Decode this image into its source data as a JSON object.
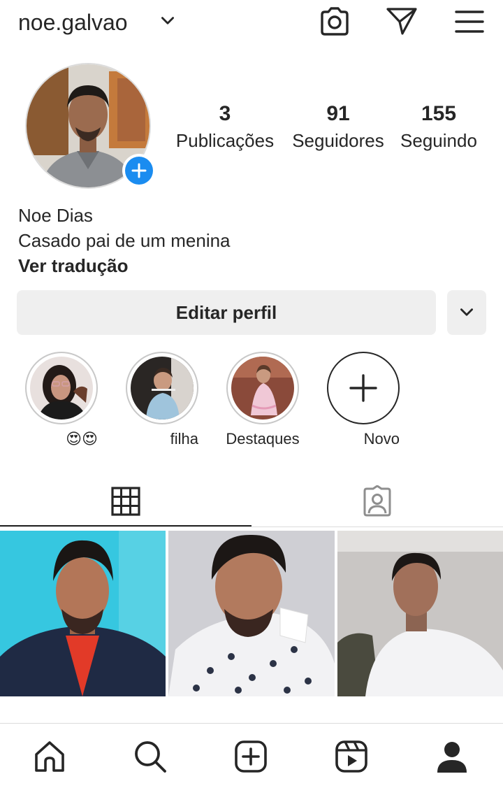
{
  "header": {
    "username": "noe.galvao",
    "icons": [
      "chevron-down-icon",
      "camera-icon",
      "direct-message-icon",
      "menu-icon"
    ]
  },
  "profile": {
    "avatar_icon": "profile-photo",
    "add_story_icon": "plus-icon",
    "accent_color": "#1a8cf0"
  },
  "stats": [
    {
      "value": "3",
      "label": "Publicações"
    },
    {
      "value": "91",
      "label": "Seguidores"
    },
    {
      "value": "155",
      "label": "Seguindo"
    }
  ],
  "bio": {
    "name": "Noe Dias",
    "text": "Casado pai de um menina",
    "translate": "Ver tradução"
  },
  "actions": {
    "edit_profile": "Editar perfil",
    "more_icon": "chevron-down-icon"
  },
  "highlights": [
    {
      "label": "😍😍"
    },
    {
      "label": "filha"
    },
    {
      "label": "Destaques"
    },
    {
      "label": "Novo"
    }
  ],
  "tabs": [
    "grid-icon",
    "tagged-icon"
  ],
  "nav": [
    "home-icon",
    "search-icon",
    "new-post-icon",
    "reels-icon",
    "profile-icon"
  ]
}
